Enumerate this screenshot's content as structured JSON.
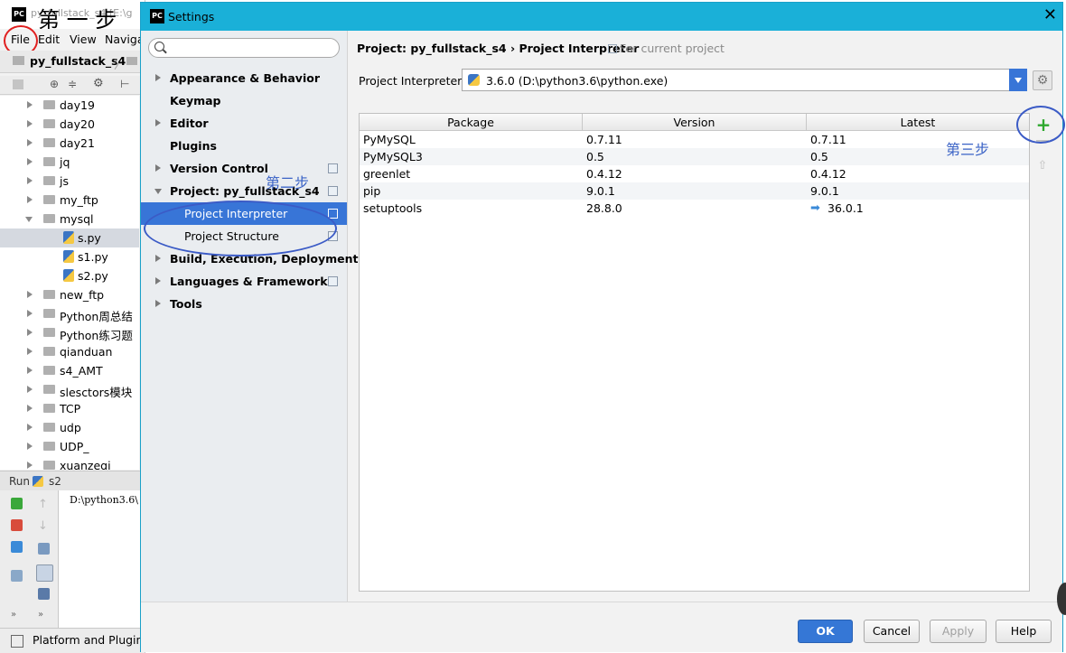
{
  "ide": {
    "title": "py_fullstack_s4  [E:\\g",
    "annotation_step1": "第 一 步",
    "menu": [
      "File",
      "Edit",
      "View",
      "Naviga"
    ],
    "breadcrumb": "py_fullstack_s4",
    "tree": [
      {
        "label": "day19",
        "type": "folder"
      },
      {
        "label": "day20",
        "type": "folder"
      },
      {
        "label": "day21",
        "type": "folder"
      },
      {
        "label": "jq",
        "type": "folder"
      },
      {
        "label": "js",
        "type": "folder"
      },
      {
        "label": "my_ftp",
        "type": "folder"
      },
      {
        "label": "mysql",
        "type": "folder-open"
      },
      {
        "label": "s.py",
        "type": "py-selected"
      },
      {
        "label": "s1.py",
        "type": "py"
      },
      {
        "label": "s2.py",
        "type": "py"
      },
      {
        "label": "new_ftp",
        "type": "folder"
      },
      {
        "label": "Python周总结",
        "type": "folder"
      },
      {
        "label": "Python练习题",
        "type": "folder"
      },
      {
        "label": "qianduan",
        "type": "folder"
      },
      {
        "label": "s4_AMT",
        "type": "folder"
      },
      {
        "label": "slesctors模块",
        "type": "folder"
      },
      {
        "label": "TCP",
        "type": "folder"
      },
      {
        "label": "udp",
        "type": "folder"
      },
      {
        "label": "UDP_",
        "type": "folder"
      },
      {
        "label": "xuanzeqi",
        "type": "folder"
      }
    ],
    "run_label": "Run",
    "run_tab": "s2",
    "console_text": "D:\\python3.6\\",
    "status_text": "Platform and Plugin"
  },
  "dialog": {
    "title": "Settings",
    "close_icon": "close-icon",
    "nav": [
      {
        "label": "Appearance & Behavior",
        "arrow": "closed",
        "level": 0
      },
      {
        "label": "Keymap",
        "arrow": "none",
        "level": 0
      },
      {
        "label": "Editor",
        "arrow": "closed",
        "level": 0
      },
      {
        "label": "Plugins",
        "arrow": "none",
        "level": 0
      },
      {
        "label": "Version Control",
        "arrow": "closed",
        "level": 0,
        "proj": true
      },
      {
        "label": "Project: py_fullstack_s4",
        "arrow": "open",
        "level": 0,
        "proj": true
      },
      {
        "label": "Project Interpreter",
        "arrow": "none",
        "level": 1,
        "proj": true,
        "selected": true
      },
      {
        "label": "Project Structure",
        "arrow": "none",
        "level": 1,
        "proj": true
      },
      {
        "label": "Build, Execution, Deployment",
        "arrow": "closed",
        "level": 0
      },
      {
        "label": "Languages & Frameworks",
        "arrow": "closed",
        "level": 0,
        "proj": true
      },
      {
        "label": "Tools",
        "arrow": "closed",
        "level": 0
      }
    ],
    "annotation_step2": "第二步",
    "breadcrumb": "Project: py_fullstack_s4 › Project Interpreter",
    "breadcrumb_note": "For current project",
    "interpreter_label": "Project Interpreter:",
    "interpreter_value": "3.6.0 (D:\\python3.6\\python.exe)",
    "table": {
      "columns": [
        "Package",
        "Version",
        "Latest"
      ],
      "rows": [
        {
          "package": "PyMySQL",
          "version": "0.7.11",
          "latest": "0.7.11",
          "upgrade": false
        },
        {
          "package": "PyMySQL3",
          "version": "0.5",
          "latest": "0.5",
          "upgrade": false
        },
        {
          "package": "greenlet",
          "version": "0.4.12",
          "latest": "0.4.12",
          "upgrade": false
        },
        {
          "package": "pip",
          "version": "9.0.1",
          "latest": "9.0.1",
          "upgrade": false
        },
        {
          "package": "setuptools",
          "version": "28.8.0",
          "latest": "36.0.1",
          "upgrade": true
        }
      ]
    },
    "add_label": "+",
    "upgrade_label": "⇧",
    "annotation_step3": "第三步",
    "buttons": {
      "ok": "OK",
      "cancel": "Cancel",
      "apply": "Apply",
      "help": "Help"
    }
  }
}
